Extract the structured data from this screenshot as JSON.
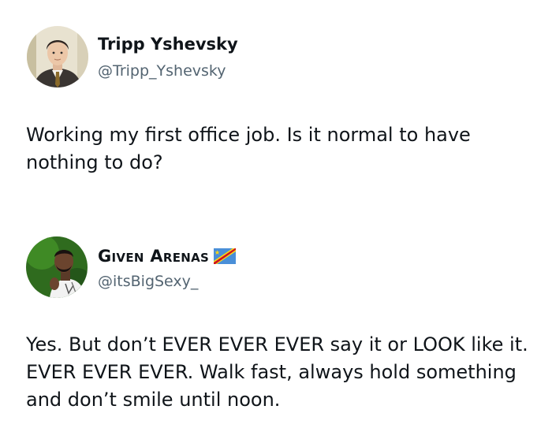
{
  "tweets": [
    {
      "display_name": "Tripp Yshevsky",
      "handle": "@Tripp_Yshevsky",
      "text": "Working my first office job. Is it normal to have nothing to do?",
      "avatar_icon": "profile-photo-man-in-suit"
    },
    {
      "display_name": "Given Arenas",
      "handle": "@itsBigSexy_",
      "text": "Yes. But don’t EVER EVER EVER say it or LOOK like it. EVER EVER EVER. Walk fast, always hold something and don’t smile until noon.",
      "avatar_icon": "profile-photo-man-green-background",
      "badge_icon": "dr-congo-flag-icon"
    }
  ],
  "colors": {
    "text": "#0f1419",
    "handle": "#536471",
    "background": "#ffffff"
  }
}
